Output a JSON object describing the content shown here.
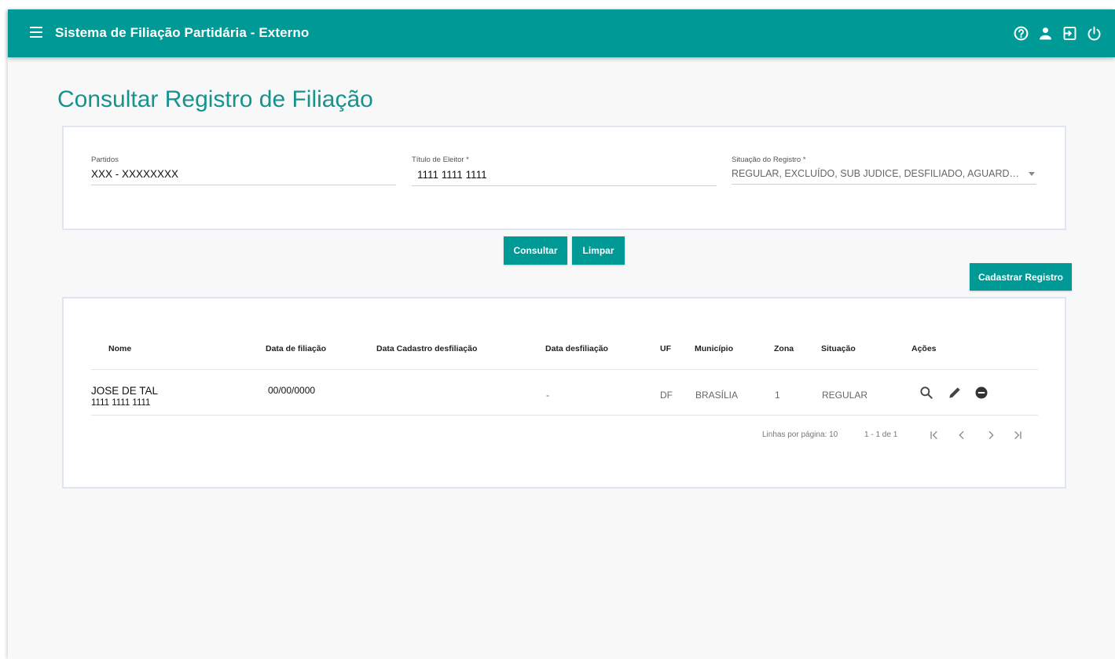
{
  "app": {
    "title": "Sistema de Filiação Partidária - Externo",
    "brand_color": "#009a96"
  },
  "top_icons": [
    "help-icon",
    "user-icon",
    "login-icon",
    "power-icon"
  ],
  "page": {
    "title": "Consultar Registro de Filiação"
  },
  "filters": {
    "partidos": {
      "label": "Partidos",
      "value": "XXX - XXXXXXXX"
    },
    "titulo": {
      "label": "Título de Eleitor *",
      "value": "1111 1111 1111"
    },
    "situacao": {
      "label": "Situação do Registro *",
      "value": "REGULAR, EXCLUÍDO, SUB JUDICE, DESFILIADO, AGUARDANDO P..."
    }
  },
  "buttons": {
    "consultar": "Consultar",
    "limpar": "Limpar",
    "cadastrar": "Cadastrar Registro"
  },
  "table": {
    "headers": {
      "nome": "Nome",
      "data_filiacao": "Data de filiação",
      "data_cadastro_desfiliacao": "Data Cadastro desfiliação",
      "data_desfiliacao": "Data desfiliação",
      "uf": "UF",
      "municipio": "Município",
      "zona": "Zona",
      "situacao": "Situação",
      "acoes": "Ações"
    },
    "rows": [
      {
        "nome": "JOSE DE TAL",
        "titulo": "1111 1111 1111",
        "data_filiacao": "00/00/0000",
        "data_cadastro_desfiliacao": "",
        "data_desfiliacao": "-",
        "uf": "DF",
        "municipio": "BRASÍLIA",
        "zona": "1",
        "situacao": "REGULAR"
      }
    ],
    "actions": [
      "search-icon",
      "edit-icon",
      "remove-icon"
    ]
  },
  "paginator": {
    "rows_per_page": "Linhas por página: 10",
    "range": "1 - 1 de 1"
  }
}
